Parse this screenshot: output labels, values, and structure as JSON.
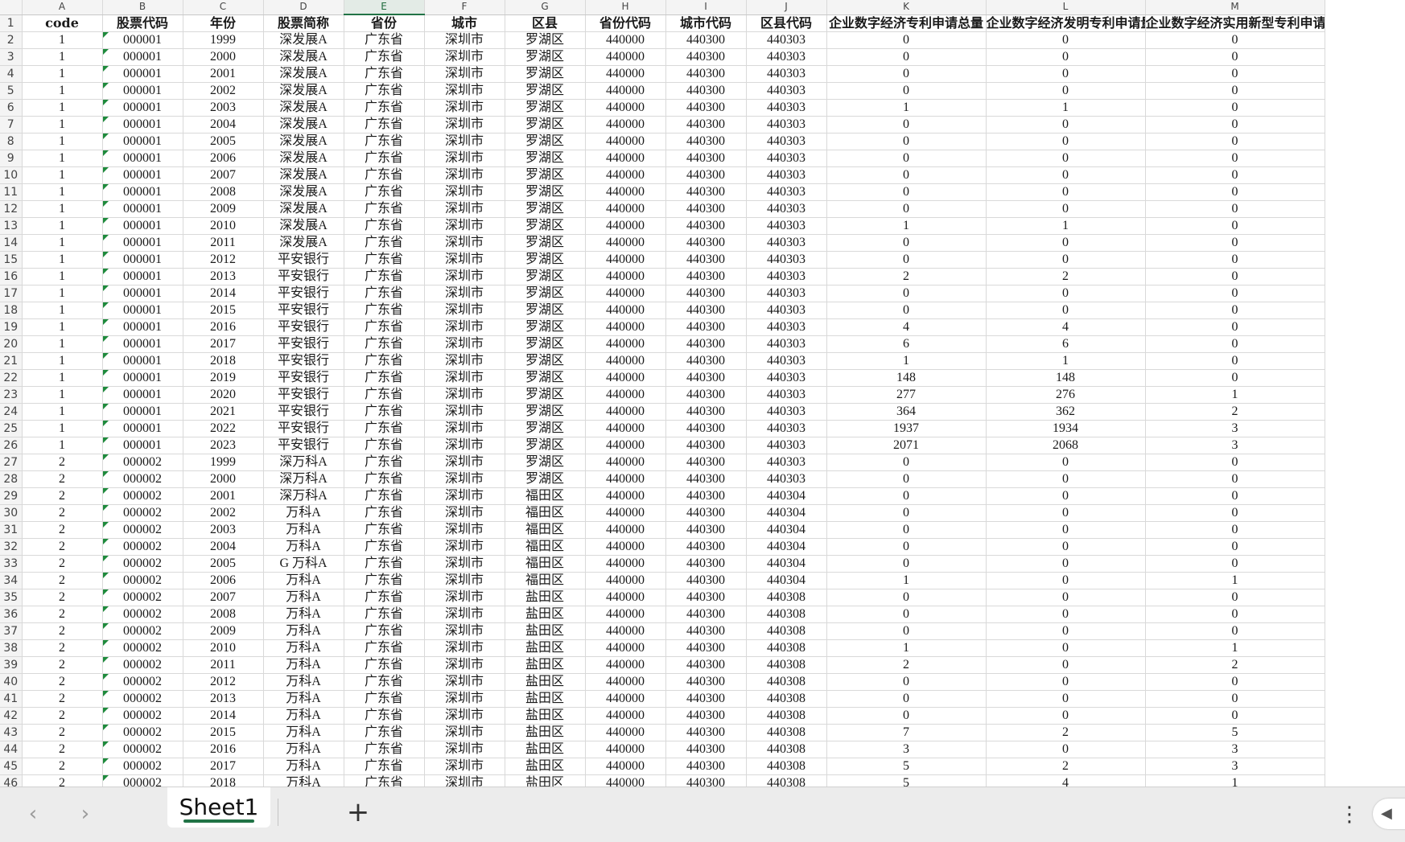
{
  "columns": [
    "A",
    "B",
    "C",
    "D",
    "E",
    "F",
    "G",
    "H",
    "I",
    "J",
    "K",
    "L",
    "M"
  ],
  "selected_column": "E",
  "headers": [
    "code",
    "股票代码",
    "年份",
    "股票简称",
    "省份",
    "城市",
    "区县",
    "省份代码",
    "城市代码",
    "区县代码",
    "企业数字经济专利申请总量",
    "企业数字经济发明专利申请量",
    "企业数字经济实用新型专利申请量"
  ],
  "rows": [
    [
      "1",
      "000001",
      "1999",
      "深发展A",
      "广东省",
      "深圳市",
      "罗湖区",
      "440000",
      "440300",
      "440303",
      "0",
      "0",
      "0"
    ],
    [
      "1",
      "000001",
      "2000",
      "深发展A",
      "广东省",
      "深圳市",
      "罗湖区",
      "440000",
      "440300",
      "440303",
      "0",
      "0",
      "0"
    ],
    [
      "1",
      "000001",
      "2001",
      "深发展A",
      "广东省",
      "深圳市",
      "罗湖区",
      "440000",
      "440300",
      "440303",
      "0",
      "0",
      "0"
    ],
    [
      "1",
      "000001",
      "2002",
      "深发展A",
      "广东省",
      "深圳市",
      "罗湖区",
      "440000",
      "440300",
      "440303",
      "0",
      "0",
      "0"
    ],
    [
      "1",
      "000001",
      "2003",
      "深发展A",
      "广东省",
      "深圳市",
      "罗湖区",
      "440000",
      "440300",
      "440303",
      "1",
      "1",
      "0"
    ],
    [
      "1",
      "000001",
      "2004",
      "深发展A",
      "广东省",
      "深圳市",
      "罗湖区",
      "440000",
      "440300",
      "440303",
      "0",
      "0",
      "0"
    ],
    [
      "1",
      "000001",
      "2005",
      "深发展A",
      "广东省",
      "深圳市",
      "罗湖区",
      "440000",
      "440300",
      "440303",
      "0",
      "0",
      "0"
    ],
    [
      "1",
      "000001",
      "2006",
      "深发展A",
      "广东省",
      "深圳市",
      "罗湖区",
      "440000",
      "440300",
      "440303",
      "0",
      "0",
      "0"
    ],
    [
      "1",
      "000001",
      "2007",
      "深发展A",
      "广东省",
      "深圳市",
      "罗湖区",
      "440000",
      "440300",
      "440303",
      "0",
      "0",
      "0"
    ],
    [
      "1",
      "000001",
      "2008",
      "深发展A",
      "广东省",
      "深圳市",
      "罗湖区",
      "440000",
      "440300",
      "440303",
      "0",
      "0",
      "0"
    ],
    [
      "1",
      "000001",
      "2009",
      "深发展A",
      "广东省",
      "深圳市",
      "罗湖区",
      "440000",
      "440300",
      "440303",
      "0",
      "0",
      "0"
    ],
    [
      "1",
      "000001",
      "2010",
      "深发展A",
      "广东省",
      "深圳市",
      "罗湖区",
      "440000",
      "440300",
      "440303",
      "1",
      "1",
      "0"
    ],
    [
      "1",
      "000001",
      "2011",
      "深发展A",
      "广东省",
      "深圳市",
      "罗湖区",
      "440000",
      "440300",
      "440303",
      "0",
      "0",
      "0"
    ],
    [
      "1",
      "000001",
      "2012",
      "平安银行",
      "广东省",
      "深圳市",
      "罗湖区",
      "440000",
      "440300",
      "440303",
      "0",
      "0",
      "0"
    ],
    [
      "1",
      "000001",
      "2013",
      "平安银行",
      "广东省",
      "深圳市",
      "罗湖区",
      "440000",
      "440300",
      "440303",
      "2",
      "2",
      "0"
    ],
    [
      "1",
      "000001",
      "2014",
      "平安银行",
      "广东省",
      "深圳市",
      "罗湖区",
      "440000",
      "440300",
      "440303",
      "0",
      "0",
      "0"
    ],
    [
      "1",
      "000001",
      "2015",
      "平安银行",
      "广东省",
      "深圳市",
      "罗湖区",
      "440000",
      "440300",
      "440303",
      "0",
      "0",
      "0"
    ],
    [
      "1",
      "000001",
      "2016",
      "平安银行",
      "广东省",
      "深圳市",
      "罗湖区",
      "440000",
      "440300",
      "440303",
      "4",
      "4",
      "0"
    ],
    [
      "1",
      "000001",
      "2017",
      "平安银行",
      "广东省",
      "深圳市",
      "罗湖区",
      "440000",
      "440300",
      "440303",
      "6",
      "6",
      "0"
    ],
    [
      "1",
      "000001",
      "2018",
      "平安银行",
      "广东省",
      "深圳市",
      "罗湖区",
      "440000",
      "440300",
      "440303",
      "1",
      "1",
      "0"
    ],
    [
      "1",
      "000001",
      "2019",
      "平安银行",
      "广东省",
      "深圳市",
      "罗湖区",
      "440000",
      "440300",
      "440303",
      "148",
      "148",
      "0"
    ],
    [
      "1",
      "000001",
      "2020",
      "平安银行",
      "广东省",
      "深圳市",
      "罗湖区",
      "440000",
      "440300",
      "440303",
      "277",
      "276",
      "1"
    ],
    [
      "1",
      "000001",
      "2021",
      "平安银行",
      "广东省",
      "深圳市",
      "罗湖区",
      "440000",
      "440300",
      "440303",
      "364",
      "362",
      "2"
    ],
    [
      "1",
      "000001",
      "2022",
      "平安银行",
      "广东省",
      "深圳市",
      "罗湖区",
      "440000",
      "440300",
      "440303",
      "1937",
      "1934",
      "3"
    ],
    [
      "1",
      "000001",
      "2023",
      "平安银行",
      "广东省",
      "深圳市",
      "罗湖区",
      "440000",
      "440300",
      "440303",
      "2071",
      "2068",
      "3"
    ],
    [
      "2",
      "000002",
      "1999",
      "深万科A",
      "广东省",
      "深圳市",
      "罗湖区",
      "440000",
      "440300",
      "440303",
      "0",
      "0",
      "0"
    ],
    [
      "2",
      "000002",
      "2000",
      "深万科A",
      "广东省",
      "深圳市",
      "罗湖区",
      "440000",
      "440300",
      "440303",
      "0",
      "0",
      "0"
    ],
    [
      "2",
      "000002",
      "2001",
      "深万科A",
      "广东省",
      "深圳市",
      "福田区",
      "440000",
      "440300",
      "440304",
      "0",
      "0",
      "0"
    ],
    [
      "2",
      "000002",
      "2002",
      "万科A",
      "广东省",
      "深圳市",
      "福田区",
      "440000",
      "440300",
      "440304",
      "0",
      "0",
      "0"
    ],
    [
      "2",
      "000002",
      "2003",
      "万科A",
      "广东省",
      "深圳市",
      "福田区",
      "440000",
      "440300",
      "440304",
      "0",
      "0",
      "0"
    ],
    [
      "2",
      "000002",
      "2004",
      "万科A",
      "广东省",
      "深圳市",
      "福田区",
      "440000",
      "440300",
      "440304",
      "0",
      "0",
      "0"
    ],
    [
      "2",
      "000002",
      "2005",
      "G 万科A",
      "广东省",
      "深圳市",
      "福田区",
      "440000",
      "440300",
      "440304",
      "0",
      "0",
      "0"
    ],
    [
      "2",
      "000002",
      "2006",
      "万科A",
      "广东省",
      "深圳市",
      "福田区",
      "440000",
      "440300",
      "440304",
      "1",
      "0",
      "1"
    ],
    [
      "2",
      "000002",
      "2007",
      "万科A",
      "广东省",
      "深圳市",
      "盐田区",
      "440000",
      "440300",
      "440308",
      "0",
      "0",
      "0"
    ],
    [
      "2",
      "000002",
      "2008",
      "万科A",
      "广东省",
      "深圳市",
      "盐田区",
      "440000",
      "440300",
      "440308",
      "0",
      "0",
      "0"
    ],
    [
      "2",
      "000002",
      "2009",
      "万科A",
      "广东省",
      "深圳市",
      "盐田区",
      "440000",
      "440300",
      "440308",
      "0",
      "0",
      "0"
    ],
    [
      "2",
      "000002",
      "2010",
      "万科A",
      "广东省",
      "深圳市",
      "盐田区",
      "440000",
      "440300",
      "440308",
      "1",
      "0",
      "1"
    ],
    [
      "2",
      "000002",
      "2011",
      "万科A",
      "广东省",
      "深圳市",
      "盐田区",
      "440000",
      "440300",
      "440308",
      "2",
      "0",
      "2"
    ],
    [
      "2",
      "000002",
      "2012",
      "万科A",
      "广东省",
      "深圳市",
      "盐田区",
      "440000",
      "440300",
      "440308",
      "0",
      "0",
      "0"
    ],
    [
      "2",
      "000002",
      "2013",
      "万科A",
      "广东省",
      "深圳市",
      "盐田区",
      "440000",
      "440300",
      "440308",
      "0",
      "0",
      "0"
    ],
    [
      "2",
      "000002",
      "2014",
      "万科A",
      "广东省",
      "深圳市",
      "盐田区",
      "440000",
      "440300",
      "440308",
      "0",
      "0",
      "0"
    ],
    [
      "2",
      "000002",
      "2015",
      "万科A",
      "广东省",
      "深圳市",
      "盐田区",
      "440000",
      "440300",
      "440308",
      "7",
      "2",
      "5"
    ],
    [
      "2",
      "000002",
      "2016",
      "万科A",
      "广东省",
      "深圳市",
      "盐田区",
      "440000",
      "440300",
      "440308",
      "3",
      "0",
      "3"
    ],
    [
      "2",
      "000002",
      "2017",
      "万科A",
      "广东省",
      "深圳市",
      "盐田区",
      "440000",
      "440300",
      "440308",
      "5",
      "2",
      "3"
    ],
    [
      "2",
      "000002",
      "2018",
      "万科A",
      "广东省",
      "深圳市",
      "盐田区",
      "440000",
      "440300",
      "440308",
      "5",
      "4",
      "1"
    ]
  ],
  "sheet_tab": {
    "label": "Sheet1"
  },
  "icons": {
    "prev": "chevron-left-icon",
    "next": "chevron-right-icon",
    "add": "plus-icon",
    "more": "more-vertical-icon",
    "scroll": "triangle-left-icon"
  },
  "colors": {
    "accent": "#217346",
    "error_marker": "#1e8a3c",
    "gridline": "#d9d9d9"
  }
}
